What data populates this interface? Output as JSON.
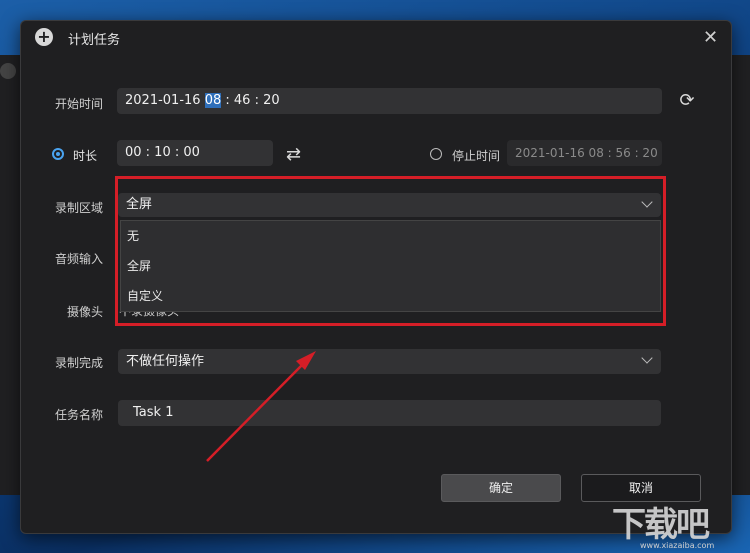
{
  "dialog": {
    "title": "计划任务"
  },
  "start_time": {
    "label": "开始时间",
    "date": "2021-01-16",
    "hour": "08",
    "rest": " : 46 : 20"
  },
  "duration": {
    "label": "时长",
    "value": "00 : 10 : 00"
  },
  "stop_time": {
    "label": "停止时间",
    "value": "2021-01-16 08 : 56 : 20"
  },
  "record_area": {
    "label": "录制区域",
    "value": "全屏",
    "options": [
      "无",
      "全屏",
      "自定义"
    ]
  },
  "audio_input": {
    "label": "音频输入"
  },
  "camera": {
    "label": "摄像头",
    "value": "不录摄像头"
  },
  "record_done": {
    "label": "录制完成",
    "value": "不做任何操作"
  },
  "task_name": {
    "label": "任务名称",
    "value": "Task 1"
  },
  "buttons": {
    "ok": "确定",
    "cancel": "取消"
  },
  "watermark": {
    "text": "下载吧",
    "url": "www.xiazaiba.com"
  },
  "colors": {
    "annotation_red": "#d51e27",
    "accent_blue": "#4aa3f0"
  }
}
